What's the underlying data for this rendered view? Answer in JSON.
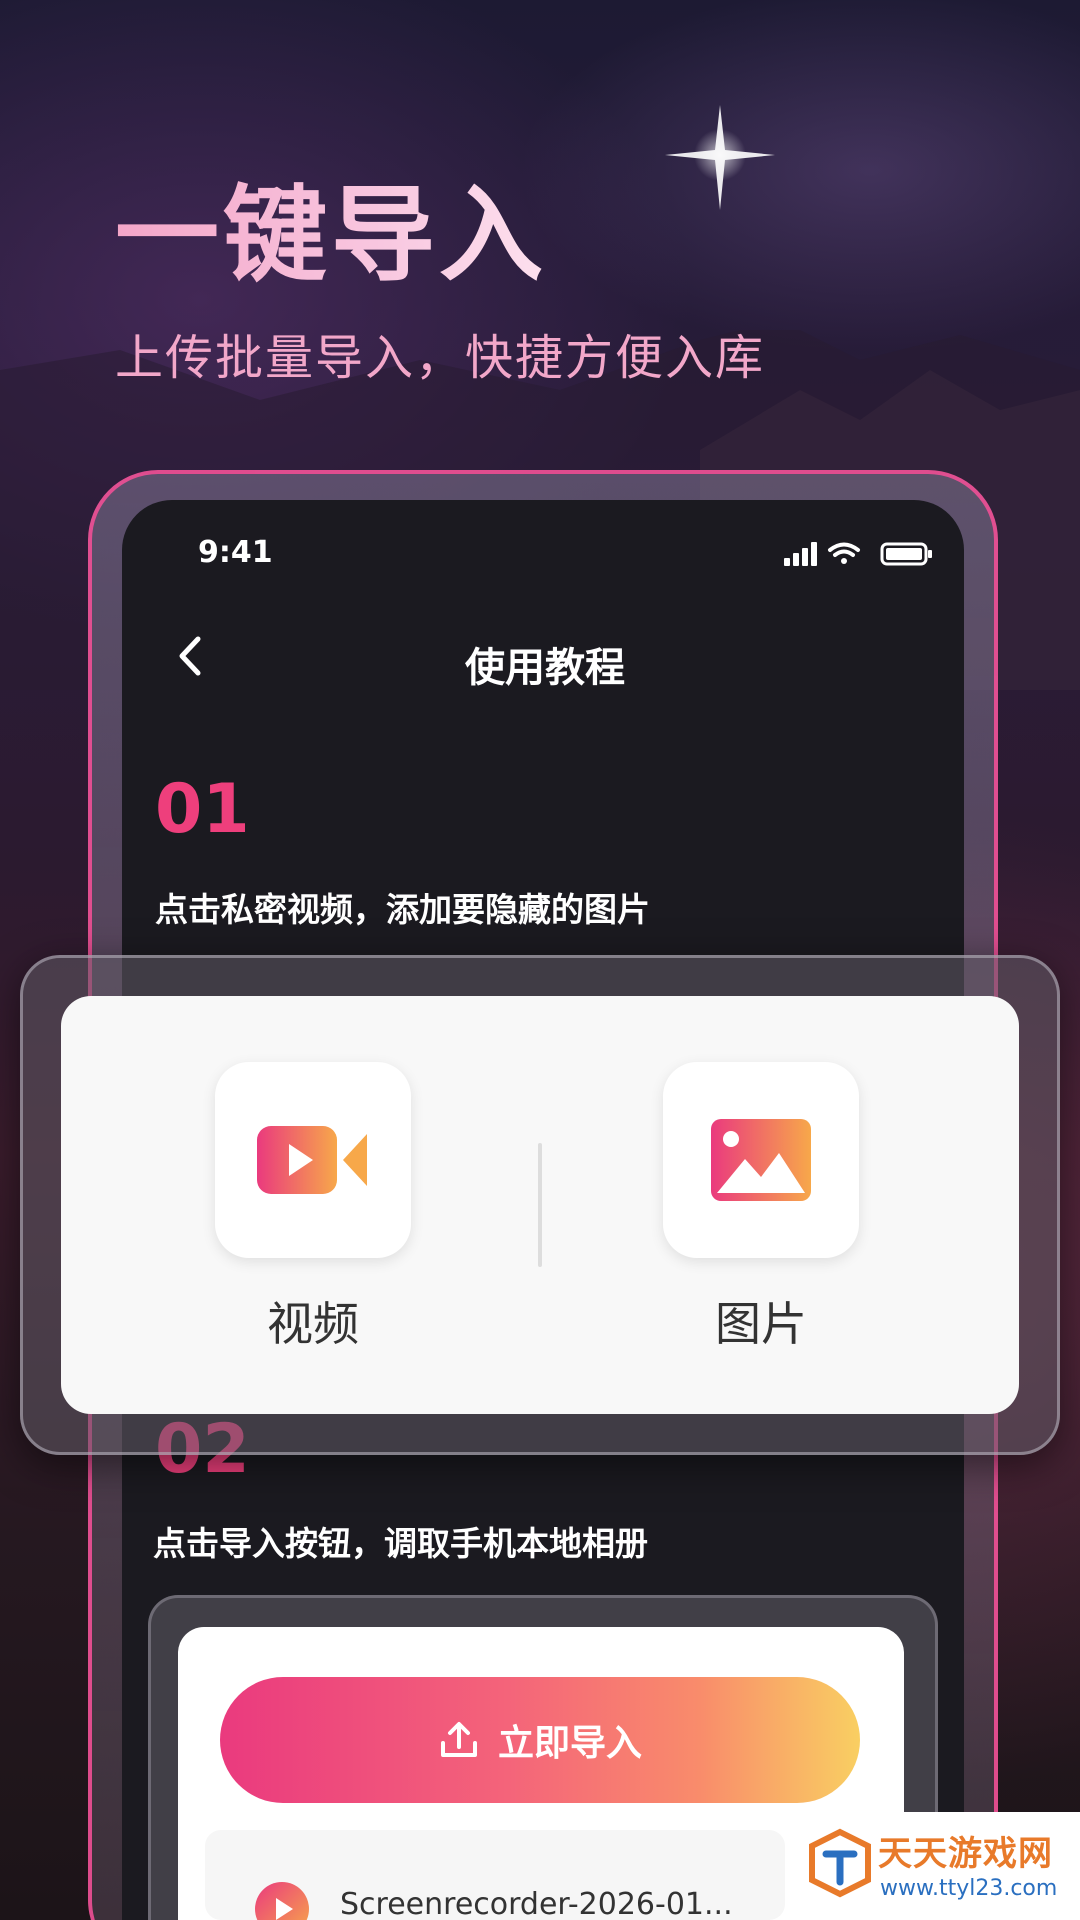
{
  "headline": "一键导入",
  "subhead": "上传批量导入，快捷方便入库",
  "status_bar": {
    "time": "9:41"
  },
  "nav": {
    "title": "使用教程"
  },
  "steps": [
    {
      "number": "01",
      "text": "点击私密视频，添加要隐藏的图片"
    },
    {
      "number": "02",
      "text": "点击导入按钮，调取手机本地相册"
    }
  ],
  "popup": {
    "options": [
      {
        "label": "视频",
        "icon": "video-camera-icon"
      },
      {
        "label": "图片",
        "icon": "image-icon"
      }
    ]
  },
  "import_panel": {
    "button_label": "立即导入",
    "button_icon": "upload-icon",
    "file_name": "Screenrecorder-2026-01..."
  },
  "watermark": {
    "title": "天天游戏网",
    "url": "www.ttyl23.com"
  },
  "colors": {
    "accent": "#ee3f7c",
    "headline_pink": "#f6b7d6",
    "gradient_start": "#ea3a7e",
    "gradient_end": "#f9cf62"
  }
}
